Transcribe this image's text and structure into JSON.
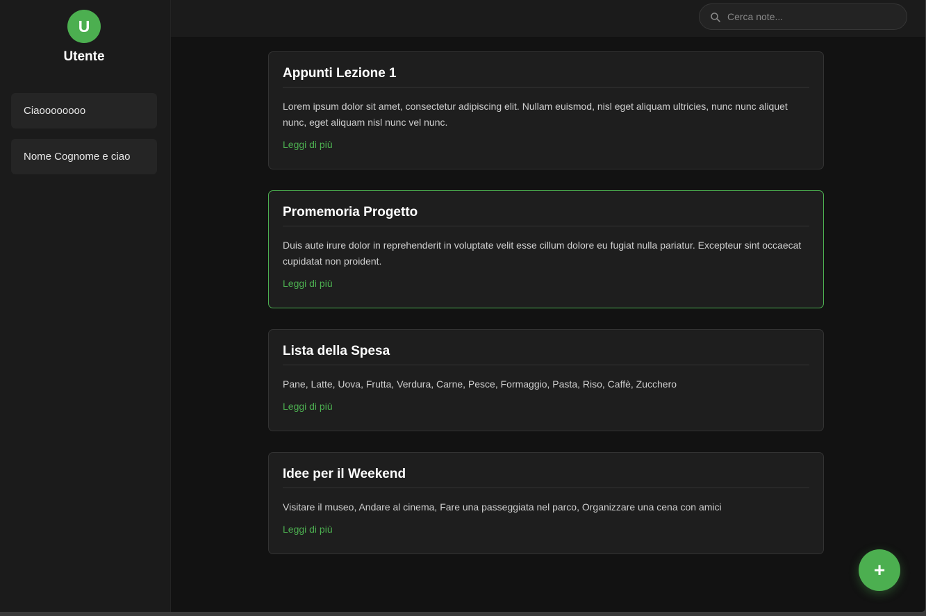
{
  "sidebar": {
    "avatar_initial": "U",
    "username": "Utente",
    "items": [
      {
        "label": "Ciaoooooooo"
      },
      {
        "label": "Nome Cognome e ciao"
      }
    ]
  },
  "search": {
    "placeholder": "Cerca note...",
    "icon": "search-icon"
  },
  "notes": [
    {
      "title": "Appunti Lezione 1",
      "text": "Lorem ipsum dolor sit amet, consectetur adipiscing elit. Nullam euismod, nisl eget aliquam ultricies, nunc nunc aliquet nunc, eget aliquam nisl nunc vel nunc.",
      "link": "Leggi di più"
    },
    {
      "title": "Promemoria Progetto",
      "text": "Duis aute irure dolor in reprehenderit in voluptate velit esse cillum dolore eu fugiat nulla pariatur. Excepteur sint occaecat cupidatat non proident.",
      "link": "Leggi di più",
      "active": true
    },
    {
      "title": "Lista della Spesa",
      "text": "Pane, Latte, Uova, Frutta, Verdura, Carne, Pesce, Formaggio, Pasta, Riso, Caffè, Zucchero",
      "link": "Leggi di più"
    },
    {
      "title": "Idee per il Weekend",
      "text": "Visitare il museo, Andare al cinema, Fare una passeggiata nel parco, Organizzare una cena con amici",
      "link": "Leggi di più"
    }
  ],
  "fab": {
    "label": "+"
  },
  "colors": {
    "accent": "#4caf50",
    "background": "#121212",
    "sidebar": "#1b1b1b",
    "card": "#1e1e1e"
  }
}
